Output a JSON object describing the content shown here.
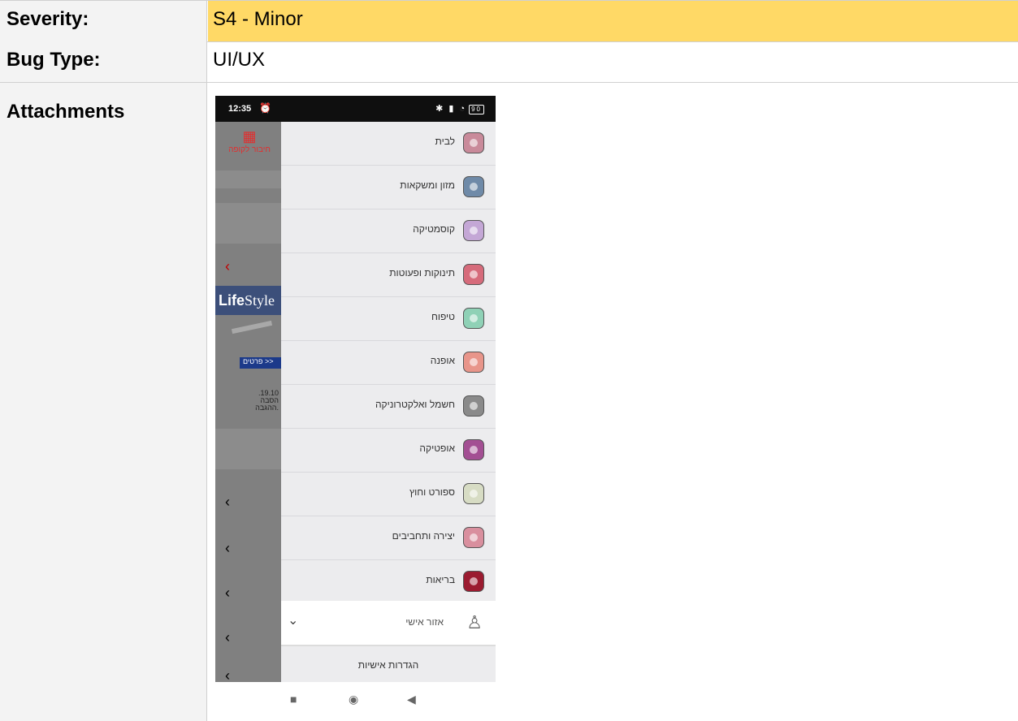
{
  "fields": {
    "severity_label": "Severity:",
    "severity_value": "S4 - Minor",
    "bugtype_label": "Bug Type:",
    "bugtype_value": "UI/UX",
    "attachments_label": "Attachments"
  },
  "colors": {
    "severity_highlight": "#ffd966",
    "label_bg": "#f3f3f3"
  },
  "phone": {
    "status": {
      "time": "12:35",
      "alarm_icon": "alarm-icon",
      "battery": "90"
    },
    "background": {
      "kupa_label": "חיבור לקופה",
      "banner_brand_bold": "Life",
      "banner_brand_rest": "Style",
      "more_button": "פרטים >>",
      "date_snippet": ".19.10\nהסבה\nההגבה."
    },
    "menu_items": [
      {
        "label": "לבית",
        "icon": "home-goods-icon",
        "color": "#c98a9a"
      },
      {
        "label": "מזון ומשקאות",
        "icon": "food-drinks-icon",
        "color": "#6f8aa8"
      },
      {
        "label": "קוסמטיקה",
        "icon": "cosmetics-icon",
        "color": "#c4a7d6"
      },
      {
        "label": "תינוקות ופעוטות",
        "icon": "baby-icon",
        "color": "#d66b7b"
      },
      {
        "label": "טיפוח",
        "icon": "grooming-icon",
        "color": "#8fd1b6"
      },
      {
        "label": "אופנה",
        "icon": "fashion-icon",
        "color": "#e8958a"
      },
      {
        "label": "חשמל ואלקטרוניקה",
        "icon": "electronics-icon",
        "color": "#8a8a8a"
      },
      {
        "label": "אופטיקה",
        "icon": "optics-icon",
        "color": "#a34f93"
      },
      {
        "label": "ספורט וחוץ",
        "icon": "sport-icon",
        "color": "#d7dcc4"
      },
      {
        "label": "יצירה ותחביבים",
        "icon": "crafts-icon",
        "color": "#d98f9e"
      },
      {
        "label": "בריאות",
        "icon": "health-icon",
        "color": "#9b1b30"
      }
    ],
    "personal_area": "אזור אישי",
    "settings": "הגדרות אישיות"
  }
}
